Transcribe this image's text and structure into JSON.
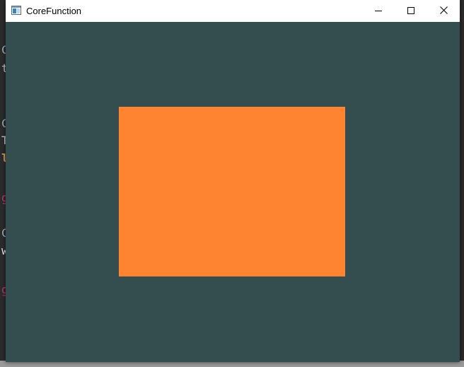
{
  "window": {
    "title": "CoreFunction",
    "clear_color": "#344e4f",
    "titlebar_color": "#ffffff"
  },
  "controls": {
    "minimize_icon": "minimize-icon",
    "maximize_icon": "maximize-icon",
    "close_icon": "close-icon"
  },
  "scene": {
    "rectangle_color": "#ff8432"
  },
  "background_glyphs": [
    {
      "text": "C",
      "color": "#9ab6c8"
    },
    {
      "text": "t",
      "color": "#c9c9c9"
    },
    {
      "text": "C",
      "color": "#9ab6c8"
    },
    {
      "text": "T",
      "color": "#c9c9c9"
    },
    {
      "text": "l",
      "color": "#d79a52"
    },
    {
      "text": "g",
      "color": "#d0306a"
    },
    {
      "text": "C",
      "color": "#9ab6c8"
    },
    {
      "text": "w",
      "color": "#e6e6e6"
    },
    {
      "text": "g",
      "color": "#d0306a"
    }
  ]
}
